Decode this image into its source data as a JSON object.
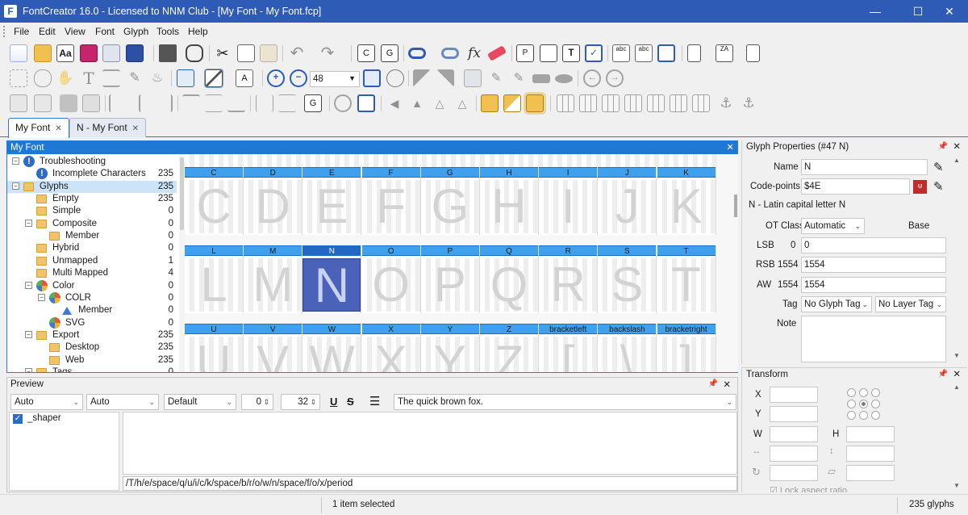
{
  "title": "FontCreator 16.0 - Licensed to NNM Club - [My Font - My Font.fcp]",
  "menu": [
    "File",
    "Edit",
    "View",
    "Font",
    "Glyph",
    "Tools",
    "Help"
  ],
  "zoom": "48",
  "tabs": [
    {
      "label": "My Font"
    },
    {
      "label": "N - My Font"
    }
  ],
  "font_panel_title": "My Font",
  "tree": [
    {
      "label": "Troubleshooting",
      "count": "",
      "depth": 1,
      "icon": "warn-icon",
      "exp": "-"
    },
    {
      "label": "Incomplete Characters",
      "count": "235",
      "depth": 2,
      "icon": "warn-icon",
      "exp": ""
    },
    {
      "label": "Glyphs",
      "count": "235",
      "depth": 1,
      "icon": "folder-icon",
      "exp": "-",
      "selected": true
    },
    {
      "label": "Empty",
      "count": "235",
      "depth": 2,
      "icon": "folder-icon",
      "exp": ""
    },
    {
      "label": "Simple",
      "count": "0",
      "depth": 2,
      "icon": "folder-icon",
      "exp": ""
    },
    {
      "label": "Composite",
      "count": "0",
      "depth": 2,
      "icon": "folder-icon",
      "exp": "-"
    },
    {
      "label": "Member",
      "count": "0",
      "depth": 3,
      "icon": "folder-icon",
      "exp": ""
    },
    {
      "label": "Hybrid",
      "count": "0",
      "depth": 2,
      "icon": "folder-icon",
      "exp": ""
    },
    {
      "label": "Unmapped",
      "count": "1",
      "depth": 2,
      "icon": "folder-icon",
      "exp": ""
    },
    {
      "label": "Multi Mapped",
      "count": "4",
      "depth": 2,
      "icon": "folder-icon",
      "exp": ""
    },
    {
      "label": "Color",
      "count": "0",
      "depth": 2,
      "icon": "pie-icon",
      "exp": "-"
    },
    {
      "label": "COLR",
      "count": "0",
      "depth": 3,
      "icon": "pie-icon",
      "exp": "-"
    },
    {
      "label": "Member",
      "count": "0",
      "depth": 4,
      "icon": "triangle-icon",
      "exp": ""
    },
    {
      "label": "SVG",
      "count": "0",
      "depth": 3,
      "icon": "pie-icon",
      "exp": ""
    },
    {
      "label": "Export",
      "count": "235",
      "depth": 2,
      "icon": "folder-icon",
      "exp": "-"
    },
    {
      "label": "Desktop",
      "count": "235",
      "depth": 3,
      "icon": "folder-icon",
      "exp": ""
    },
    {
      "label": "Web",
      "count": "235",
      "depth": 3,
      "icon": "folder-icon",
      "exp": ""
    },
    {
      "label": "Tags",
      "count": "0",
      "depth": 2,
      "icon": "folder-icon",
      "exp": "-"
    }
  ],
  "glyph_rows": [
    {
      "labels": [
        "C",
        "D",
        "E",
        "F",
        "G",
        "H",
        "I",
        "J",
        "K"
      ],
      "glyphs": [
        "C",
        "D",
        "E",
        "F",
        "G",
        "H",
        "I",
        "J",
        "K"
      ]
    },
    {
      "labels": [
        "L",
        "M",
        "N",
        "O",
        "P",
        "Q",
        "R",
        "S",
        "T"
      ],
      "glyphs": [
        "L",
        "M",
        "N",
        "O",
        "P",
        "Q",
        "R",
        "S",
        "T"
      ]
    },
    {
      "labels": [
        "U",
        "V",
        "W",
        "X",
        "Y",
        "Z",
        "bracketleft",
        "backslash",
        "bracketright"
      ],
      "glyphs": [
        "U",
        "V",
        "W",
        "X",
        "Y",
        "Z",
        "[",
        "\\",
        "]"
      ]
    }
  ],
  "selected_glyph": "N",
  "properties": {
    "title": "Glyph Properties (#47 N)",
    "name_label": "Name",
    "name": "N",
    "codepoints_label": "Code-points",
    "codepoints": "$4E",
    "description": "N - Latin capital letter N",
    "otclass_label": "OT Class",
    "otclass": "Automatic",
    "base": "Base",
    "lsb_label": "LSB",
    "lsb_cur": "0",
    "lsb": "0",
    "rsb_label": "RSB",
    "rsb_cur": "1554",
    "rsb": "1554",
    "aw_label": "AW",
    "aw_cur": "1554",
    "aw": "1554",
    "tag_label": "Tag",
    "glyph_tag": "No Glyph Tag",
    "layer_tag": "No Layer Tag",
    "note_label": "Note"
  },
  "transform": {
    "title": "Transform",
    "x": "X",
    "y": "Y",
    "w": "W",
    "h": "H",
    "lock": "Lock aspect ratio"
  },
  "preview": {
    "title": "Preview",
    "script": "Auto",
    "language": "Auto",
    "features": "Default",
    "spacing": "0",
    "size": "32",
    "text": "The quick brown fox.",
    "shaper": "_shaper",
    "sequence": "/T/h/e/space/q/u/i/c/k/space/b/r/o/w/n/space/f/o/x/period"
  },
  "status": {
    "selection": "1 item selected",
    "glyph_count": "235 glyphs"
  },
  "colors": {
    "titlebar": "#2d5bb5",
    "accent": "#1e78d6",
    "selected_glyph": "#4a63b8"
  }
}
